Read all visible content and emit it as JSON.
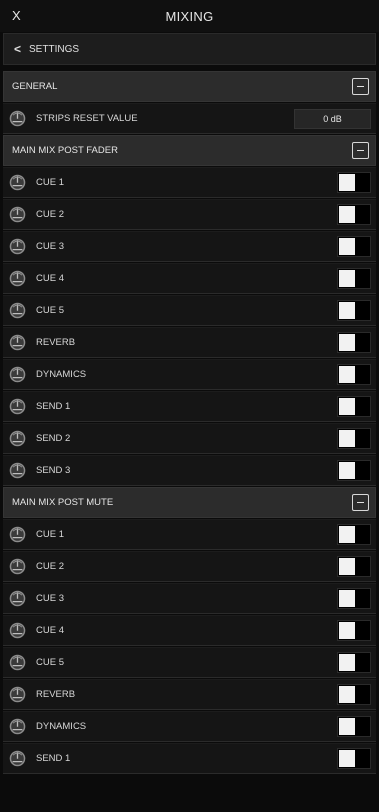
{
  "title_bar": {
    "close_label": "X",
    "title": "MIXING"
  },
  "back": {
    "chevron": "<",
    "label": "SETTINGS"
  },
  "sections": [
    {
      "header": "GENERAL",
      "rows": [
        {
          "label": "STRIPS RESET VALUE",
          "value": "0 dB"
        }
      ]
    },
    {
      "header": "MAIN MIX POST FADER",
      "rows": [
        {
          "label": "CUE 1",
          "toggle": false
        },
        {
          "label": "CUE 2",
          "toggle": false
        },
        {
          "label": "CUE 3",
          "toggle": false
        },
        {
          "label": "CUE 4",
          "toggle": false
        },
        {
          "label": "CUE 5",
          "toggle": false
        },
        {
          "label": "REVERB",
          "toggle": false
        },
        {
          "label": "DYNAMICS",
          "toggle": false
        },
        {
          "label": "SEND 1",
          "toggle": false
        },
        {
          "label": "SEND 2",
          "toggle": false
        },
        {
          "label": "SEND 3",
          "toggle": false
        }
      ]
    },
    {
      "header": "MAIN MIX POST MUTE",
      "rows": [
        {
          "label": "CUE 1",
          "toggle": false
        },
        {
          "label": "CUE 2",
          "toggle": false
        },
        {
          "label": "CUE 3",
          "toggle": false
        },
        {
          "label": "CUE 4",
          "toggle": false
        },
        {
          "label": "CUE 5",
          "toggle": false
        },
        {
          "label": "REVERB",
          "toggle": false
        },
        {
          "label": "DYNAMICS",
          "toggle": false
        },
        {
          "label": "SEND 1",
          "toggle": false
        }
      ]
    }
  ],
  "icons": {
    "row_icon": "knob-icon",
    "collapse_icon": "minus-icon"
  }
}
